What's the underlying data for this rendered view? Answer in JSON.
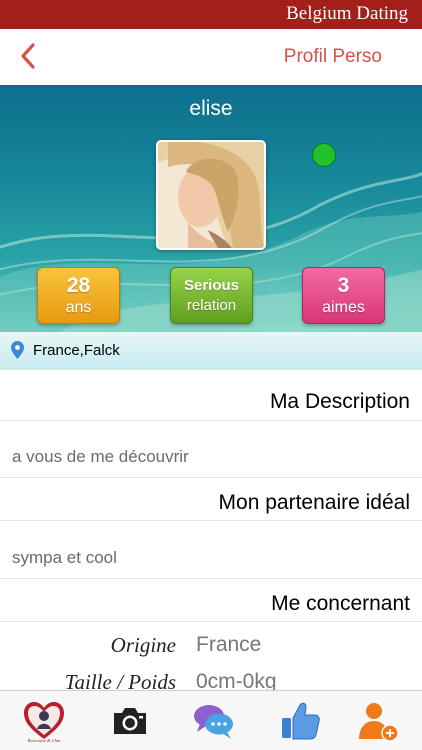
{
  "app": {
    "brand": "Belgium Dating"
  },
  "nav": {
    "title": "Profil Perso"
  },
  "profile": {
    "username": "elise",
    "online": true,
    "age_value": "28",
    "age_unit": "ans",
    "relation_line1": "Serious",
    "relation_line2": "relation",
    "likes_value": "3",
    "likes_unit": "aimes",
    "location": "France,Falck"
  },
  "sections": {
    "description_title": "Ma Description",
    "description_text": "a vous de me découvrir",
    "partner_title": "Mon partenaire idéal",
    "partner_text": "sympa et cool",
    "about_title": "Me concernant"
  },
  "details": [
    {
      "label": "Origine",
      "value": "France"
    },
    {
      "label": "Taille / Poids",
      "value": "0cm-0kg"
    }
  ],
  "tabbar": {
    "items": [
      {
        "icon": "heart-logo-icon",
        "logo_text": "Rencontre & Chat"
      },
      {
        "icon": "camera-icon"
      },
      {
        "icon": "chat-bubbles-icon"
      },
      {
        "icon": "thumbs-up-icon"
      },
      {
        "icon": "add-user-icon"
      }
    ]
  },
  "colors": {
    "brand_bar": "#a31f1c",
    "nav_accent": "#d8504a",
    "online": "#21c22a",
    "age_badge": "#f2b22a",
    "relation_badge": "#7cbc35",
    "likes_badge": "#e84f8a"
  }
}
